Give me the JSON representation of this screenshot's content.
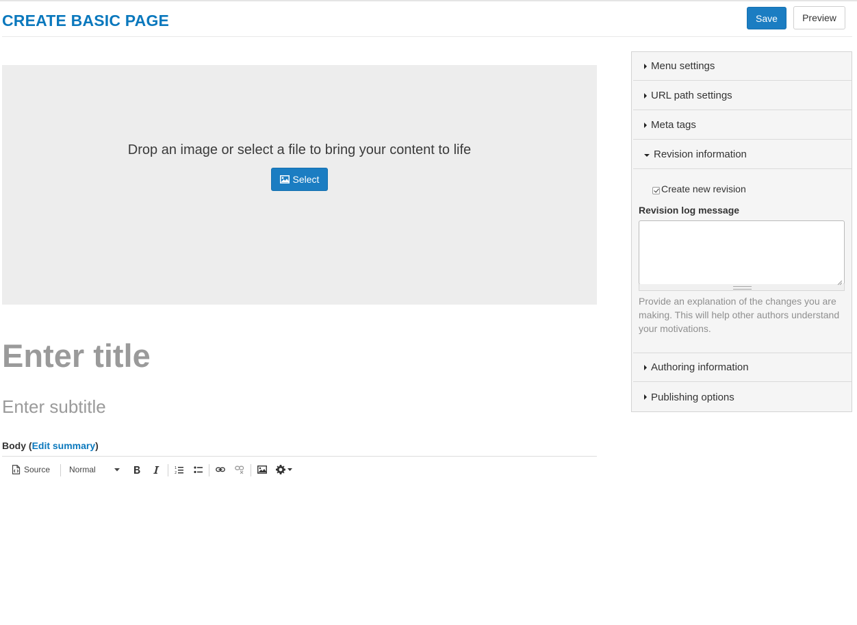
{
  "header": {
    "title": "CREATE BASIC PAGE",
    "save_label": "Save",
    "preview_label": "Preview"
  },
  "hero": {
    "drop_text": "Drop an image or select a file to bring your content to life",
    "select_label": "Select",
    "select_icon": "image-icon"
  },
  "fields": {
    "title_placeholder": "Enter title",
    "subtitle_placeholder": "Enter subtitle"
  },
  "body": {
    "label": "Body",
    "paren_open": " (",
    "edit_summary": "Edit summary",
    "paren_close": ")"
  },
  "toolbar": {
    "source_label": "Source",
    "format_value": "Normal",
    "icons": [
      "source-icon",
      "bold-icon",
      "italic-icon",
      "numbered-list-icon",
      "bulleted-list-icon",
      "link-icon",
      "unlink-icon",
      "image-icon",
      "gear-icon"
    ]
  },
  "sidebar": {
    "items": [
      {
        "label": "Menu settings",
        "expanded": false
      },
      {
        "label": "URL path settings",
        "expanded": false
      },
      {
        "label": "Meta tags",
        "expanded": false
      },
      {
        "label": "Revision information",
        "expanded": true
      },
      {
        "label": "Authoring information",
        "expanded": false
      },
      {
        "label": "Publishing options",
        "expanded": false
      }
    ],
    "revision": {
      "create_new_label": "Create new revision",
      "create_new_checked": true,
      "log_label": "Revision log message",
      "log_value": "",
      "help_text": "Provide an explanation of the changes you are making. This will help other authors understand your motivations."
    }
  },
  "colors": {
    "accent": "#1b7dc2",
    "title_blue": "#0a78bd",
    "dropzone_bg": "#ededed",
    "sidebar_bg": "#f5f5f5"
  }
}
